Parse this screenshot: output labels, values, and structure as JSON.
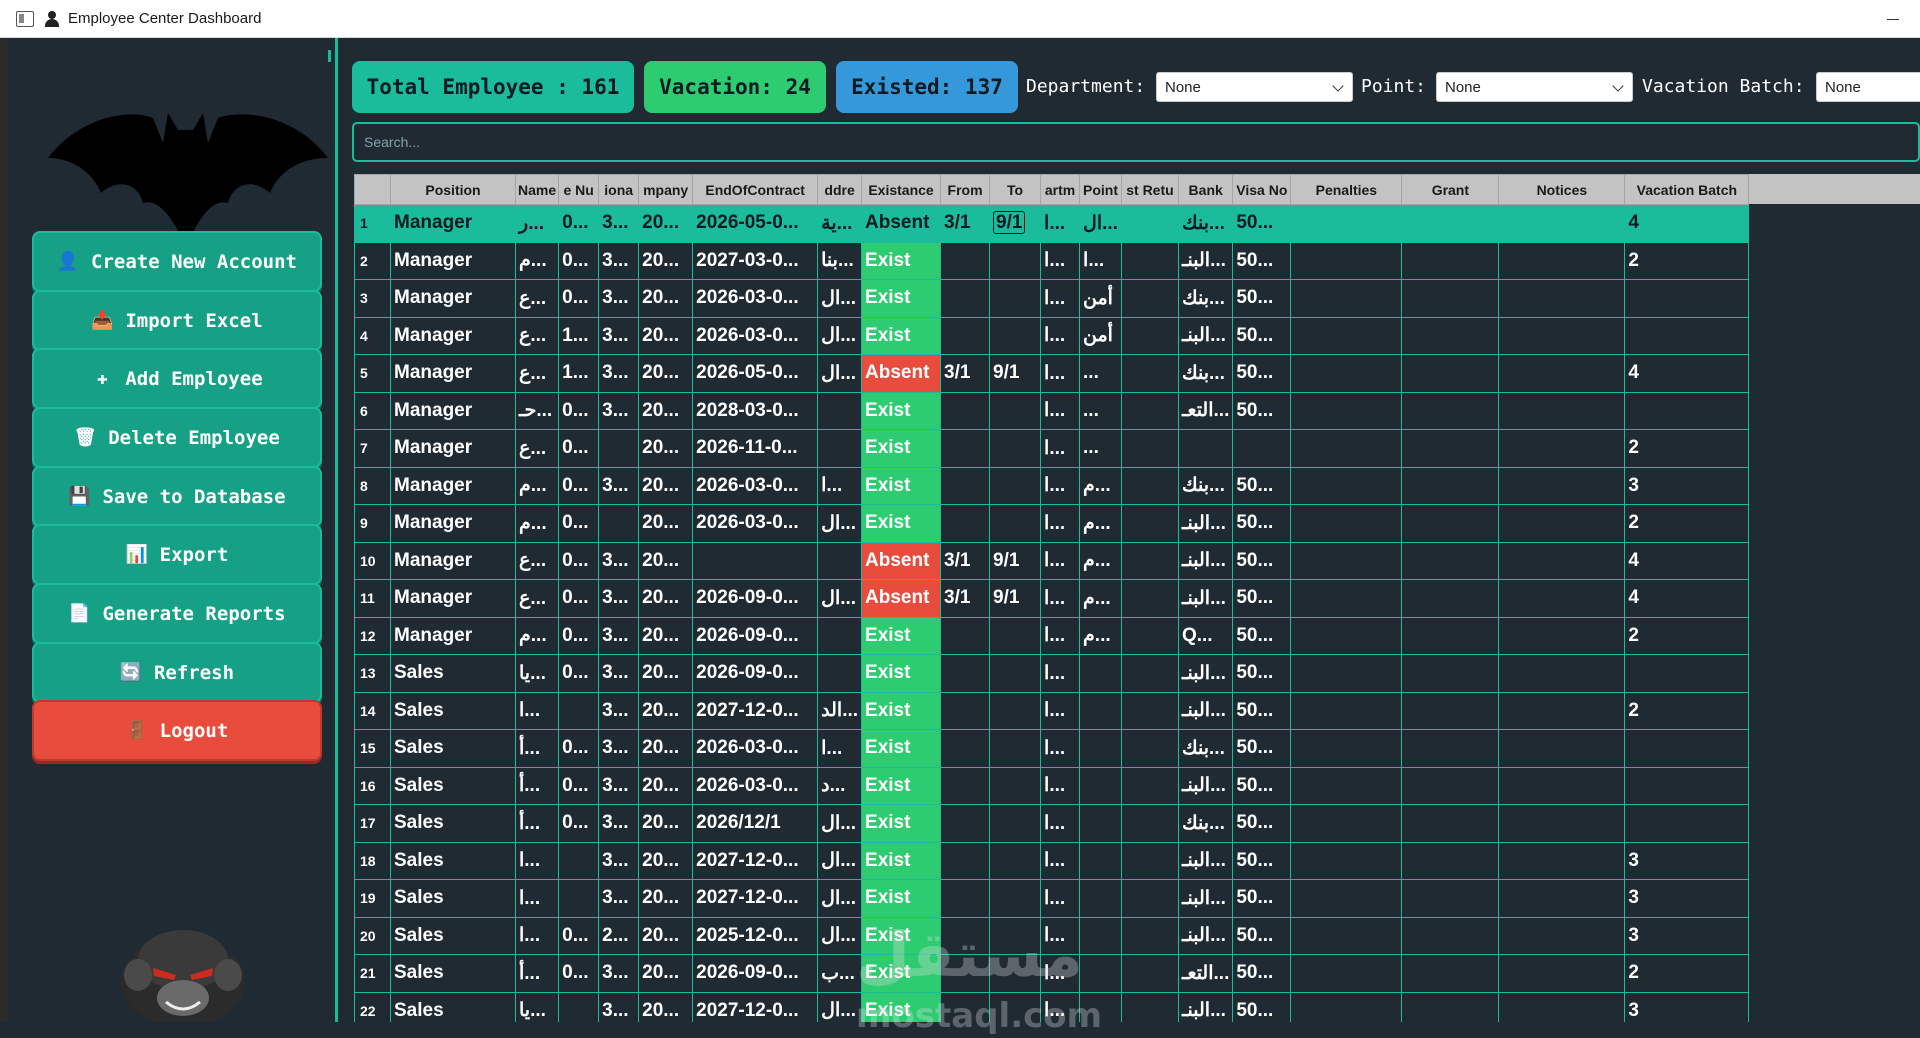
{
  "window": {
    "title": "Employee Center Dashboard"
  },
  "sidebar": {
    "buttons": [
      {
        "label": "Create New Account",
        "icon": "person-icon"
      },
      {
        "label": "Import Excel",
        "icon": "import-icon"
      },
      {
        "label": "Add Employee",
        "icon": "plus-icon"
      },
      {
        "label": "Delete Employee",
        "icon": "trash-icon"
      },
      {
        "label": "Save to Database",
        "icon": "floppy-icon"
      },
      {
        "label": "Export",
        "icon": "chart-icon"
      },
      {
        "label": "Generate Reports",
        "icon": "document-icon"
      },
      {
        "label": "Refresh",
        "icon": "refresh-icon"
      },
      {
        "label": "Logout",
        "icon": "door-icon"
      }
    ]
  },
  "stats": {
    "total": "Total Employee : 161",
    "vacation": "Vacation: 24",
    "existed": "Existed: 137"
  },
  "filters": {
    "department_label": "Department:",
    "department_value": "None",
    "point_label": "Point:",
    "point_value": "None",
    "batch_label": "Vacation Batch:",
    "batch_value": "None"
  },
  "search": {
    "placeholder": "Search..."
  },
  "table": {
    "columns": [
      "Position",
      "Name",
      "e Nu",
      "iona",
      "mpany",
      "EndOfContract",
      "ddre",
      "Existance",
      "From",
      "To",
      "artm",
      "Point",
      "st Retu",
      "Bank",
      "Visa No",
      "Penalties",
      "Grant",
      "Notices",
      "Vacation Batch"
    ],
    "rows": [
      [
        "Manager",
        "ر...",
        "0...",
        "3...",
        "20...",
        "2026-05-0...",
        "ية...",
        "Absent",
        "3/1",
        "9/1",
        "ا...",
        "ال...",
        "",
        "بنك...",
        "50...",
        "",
        "",
        "",
        "4"
      ],
      [
        "Manager",
        "م...",
        "0...",
        "3...",
        "20...",
        "2027-03-0...",
        "بنا...",
        "Exist",
        "",
        "",
        "ا...",
        "ا...",
        "",
        "البنـ...",
        "50...",
        "",
        "",
        "",
        "2"
      ],
      [
        "Manager",
        "ع...",
        "0...",
        "3...",
        "20...",
        "2026-03-0...",
        "ال...",
        "Exist",
        "",
        "",
        "ا...",
        "أمن",
        "",
        "بنك...",
        "50...",
        "",
        "",
        "",
        ""
      ],
      [
        "Manager",
        "ع...",
        "1...",
        "3...",
        "20...",
        "2026-03-0...",
        "ال...",
        "Exist",
        "",
        "",
        "ا...",
        "أمن",
        "",
        "البنـ...",
        "50...",
        "",
        "",
        "",
        ""
      ],
      [
        "Manager",
        "ع...",
        "1...",
        "3...",
        "20...",
        "2026-05-0...",
        "ال...",
        "Absent",
        "3/1",
        "9/1",
        "ا...",
        "...",
        "",
        "بنك...",
        "50...",
        "",
        "",
        "",
        "4"
      ],
      [
        "Manager",
        "حـ...",
        "0...",
        "3...",
        "20...",
        "2028-03-0...",
        "",
        "Exist",
        "",
        "",
        "ا...",
        "...",
        "",
        "التعـ...",
        "50...",
        "",
        "",
        "",
        ""
      ],
      [
        "Manager",
        "ع...",
        "0...",
        "",
        "20...",
        "2026-11-0...",
        "",
        "Exist",
        "",
        "",
        "ا...",
        "...",
        "",
        "",
        "",
        "",
        "",
        "",
        "2"
      ],
      [
        "Manager",
        "م...",
        "0...",
        "3...",
        "20...",
        "2026-03-0...",
        "ا...",
        "Exist",
        "",
        "",
        "ا...",
        "م...",
        "",
        "بنك...",
        "50...",
        "",
        "",
        "",
        "3"
      ],
      [
        "Manager",
        "م...",
        "0...",
        "",
        "20...",
        "2026-03-0...",
        "ال...",
        "Exist",
        "",
        "",
        "ا...",
        "م...",
        "",
        "البنـ...",
        "50...",
        "",
        "",
        "",
        "2"
      ],
      [
        "Manager",
        "ع...",
        "0...",
        "3...",
        "20...",
        "",
        "",
        "Absent",
        "3/1",
        "9/1",
        "ا...",
        "م...",
        "",
        "البنـ...",
        "50...",
        "",
        "",
        "",
        "4"
      ],
      [
        "Manager",
        "ع...",
        "0...",
        "3...",
        "20...",
        "2026-09-0...",
        "ال...",
        "Absent",
        "3/1",
        "9/1",
        "ا...",
        "م...",
        "",
        "البنـ...",
        "50...",
        "",
        "",
        "",
        "4"
      ],
      [
        "Manager",
        "م...",
        "0...",
        "3...",
        "20...",
        "2026-09-0...",
        "",
        "Exist",
        "",
        "",
        "ا...",
        "م...",
        "",
        "Q...",
        "50...",
        "",
        "",
        "",
        "2"
      ],
      [
        "Sales",
        "يا...",
        "0...",
        "3...",
        "20...",
        "2026-09-0...",
        "",
        "Exist",
        "",
        "",
        "ا...",
        "",
        "",
        "البنـ...",
        "50...",
        "",
        "",
        "",
        ""
      ],
      [
        "Sales",
        "ا...",
        "",
        "3...",
        "20...",
        "2027-12-0...",
        "الد...",
        "Exist",
        "",
        "",
        "ا...",
        "",
        "",
        "البنـ...",
        "50...",
        "",
        "",
        "",
        "2"
      ],
      [
        "Sales",
        "أ...",
        "0...",
        "3...",
        "20...",
        "2026-03-0...",
        "ا...",
        "Exist",
        "",
        "",
        "ا...",
        "",
        "",
        "بنك...",
        "50...",
        "",
        "",
        "",
        ""
      ],
      [
        "Sales",
        "أ...",
        "0...",
        "3...",
        "20...",
        "2026-03-0...",
        "د...",
        "Exist",
        "",
        "",
        "ا...",
        "",
        "",
        "البنـ...",
        "50...",
        "",
        "",
        "",
        ""
      ],
      [
        "Sales",
        "أ...",
        "0...",
        "3...",
        "20...",
        "2026/12/1",
        "ال...",
        "Exist",
        "",
        "",
        "ا...",
        "",
        "",
        "بنك...",
        "50...",
        "",
        "",
        "",
        ""
      ],
      [
        "Sales",
        "ا...",
        "",
        "3...",
        "20...",
        "2027-12-0...",
        "ال...",
        "Exist",
        "",
        "",
        "ا...",
        "",
        "",
        "البنـ...",
        "50...",
        "",
        "",
        "",
        "3"
      ],
      [
        "Sales",
        "ا...",
        "",
        "3...",
        "20...",
        "2027-12-0...",
        "ال...",
        "Exist",
        "",
        "",
        "ا...",
        "",
        "",
        "البنـ...",
        "50...",
        "",
        "",
        "",
        "3"
      ],
      [
        "Sales",
        "ا...",
        "0...",
        "2...",
        "20...",
        "2025-12-0...",
        "ال...",
        "Exist",
        "",
        "",
        "ا...",
        "",
        "",
        "البنـ...",
        "50...",
        "",
        "",
        "",
        "3"
      ],
      [
        "Sales",
        "أ...",
        "0...",
        "3...",
        "20...",
        "2026-09-0...",
        "ب...",
        "Exist",
        "",
        "",
        "ا...",
        "",
        "",
        "التعـ...",
        "50...",
        "",
        "",
        "",
        "2"
      ],
      [
        "Sales",
        "يا...",
        "",
        "3...",
        "20...",
        "2027-12-0...",
        "ال...",
        "Exist",
        "",
        "",
        "ا...",
        "",
        "",
        "البنـ...",
        "50...",
        "",
        "",
        "",
        "3"
      ]
    ]
  },
  "watermark": {
    "arabic": "مستقل",
    "latin": "mostaql.com"
  }
}
